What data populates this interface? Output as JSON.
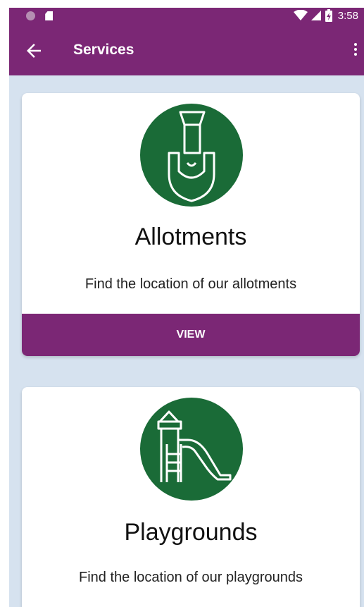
{
  "status_bar": {
    "time": "3:58",
    "icons": [
      "notification-dot-icon",
      "sd-card-icon",
      "wifi-icon",
      "signal-icon",
      "battery-charging-icon"
    ]
  },
  "app_bar": {
    "title": "Services",
    "back_icon": "arrow-back-icon",
    "menu_icon": "more-vertical-icon"
  },
  "services": [
    {
      "title": "Allotments",
      "description": "Find the location of our allotments",
      "button_label": "VIEW",
      "icon": "spade-icon"
    },
    {
      "title": "Playgrounds",
      "description": "Find the location of our playgrounds",
      "icon": "playground-slide-icon"
    }
  ],
  "colors": {
    "primary": "#7b2775",
    "icon_circle": "#1a6b37",
    "background": "#d6e2ef",
    "card": "#ffffff"
  }
}
